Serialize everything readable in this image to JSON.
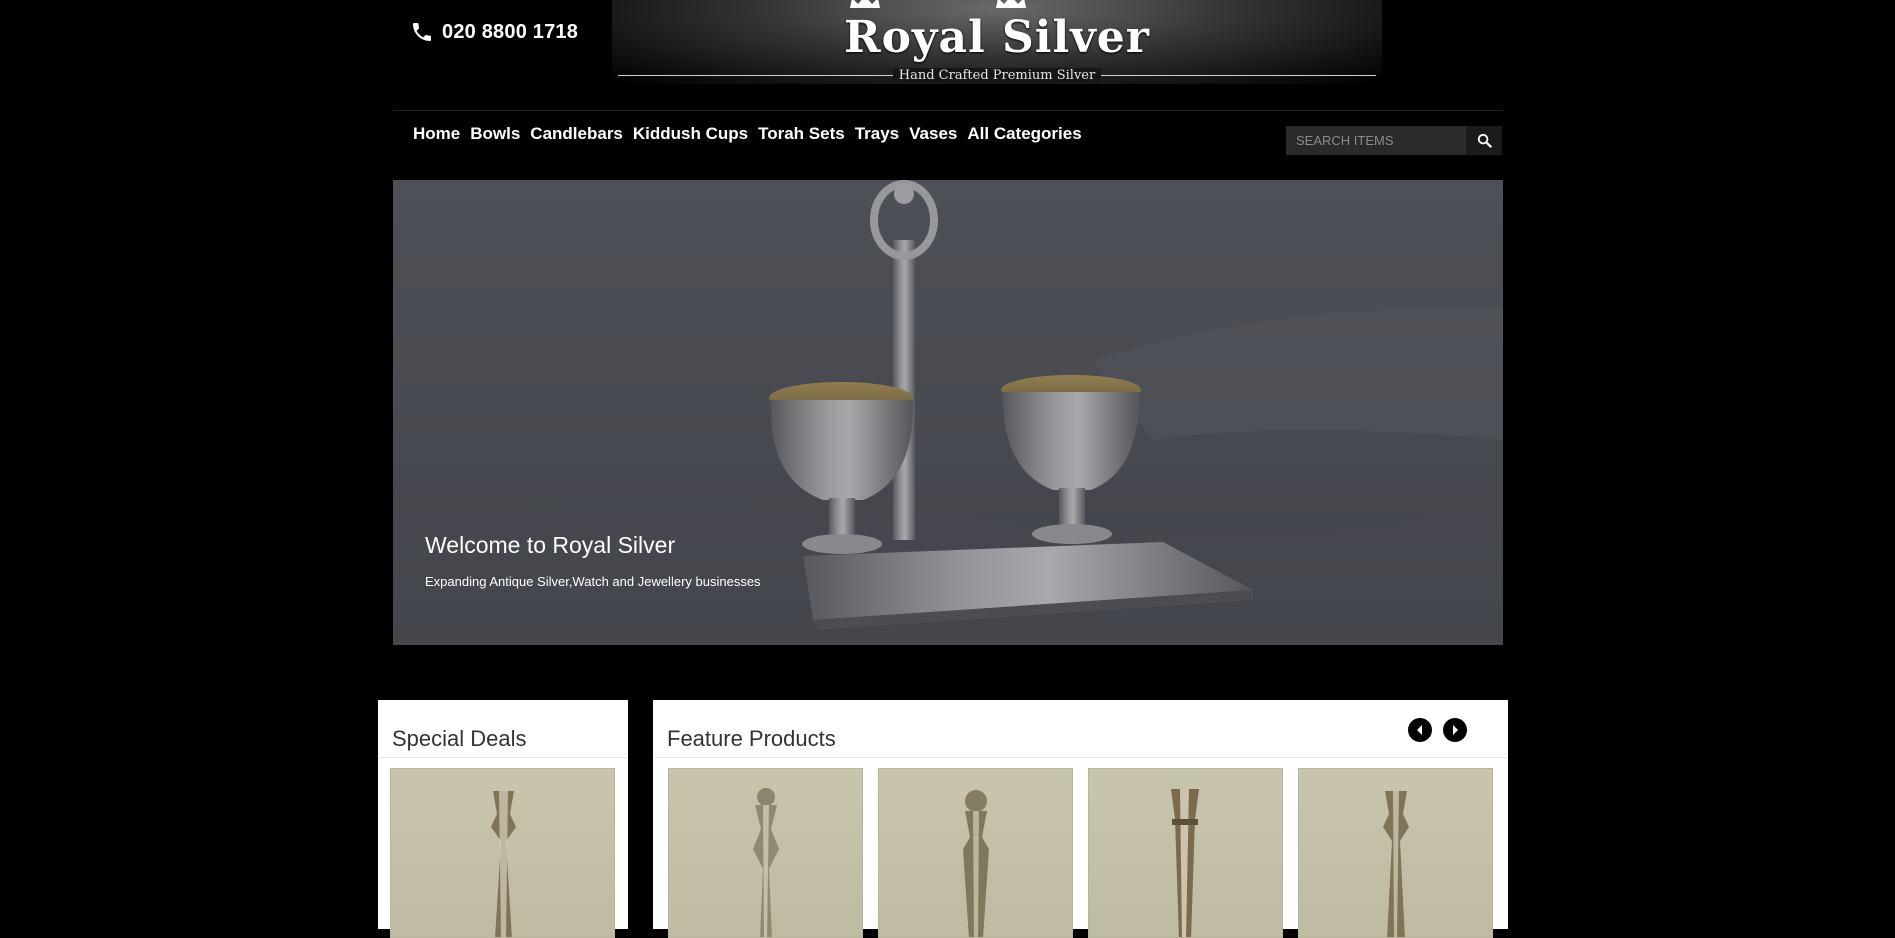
{
  "header": {
    "phone": "020 8800 1718",
    "logo_name": "Royal Silver",
    "logo_tagline": "Hand Crafted Premium Silver"
  },
  "nav": {
    "items": [
      "Home",
      "Bowls",
      "Candlebars",
      "Kiddush Cups",
      "Torah Sets",
      "Trays",
      "Vases",
      "All Categories"
    ]
  },
  "search": {
    "placeholder": "SEARCH ITEMS"
  },
  "hero": {
    "title": "Welcome to Royal Silver",
    "subtitle": "Expanding Antique Silver,Watch and Jewellery businesses"
  },
  "special_deals": {
    "title": "Special Deals"
  },
  "feature_products": {
    "title": "Feature Products"
  },
  "icons": [
    "phone-icon",
    "crown-icon",
    "search-icon",
    "chevron-left-icon",
    "chevron-right-icon"
  ]
}
